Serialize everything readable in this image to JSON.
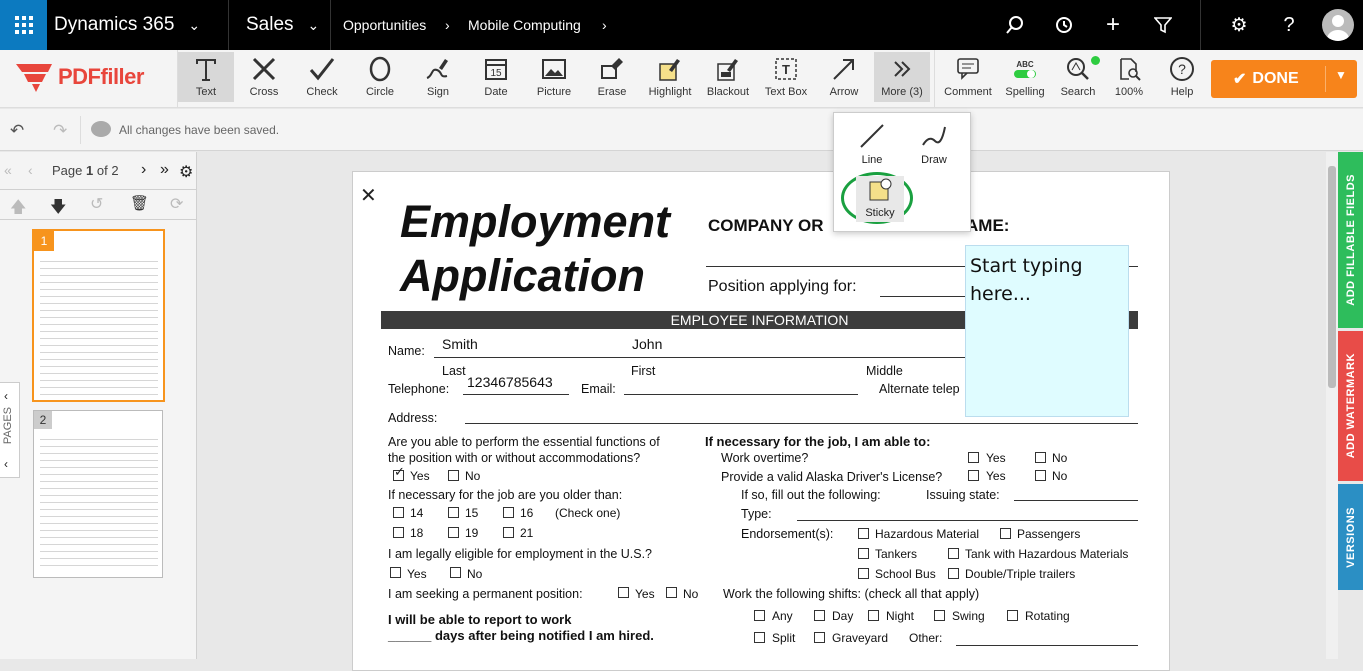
{
  "topbar": {
    "app": "Dynamics 365",
    "module": "Sales",
    "crumb1": "Opportunities",
    "crumb2": "Mobile Computing"
  },
  "logo": "PDFfiller",
  "tools": [
    {
      "label": "Text",
      "icon": "text-icon"
    },
    {
      "label": "Cross",
      "icon": "cross-icon"
    },
    {
      "label": "Check",
      "icon": "check-icon"
    },
    {
      "label": "Circle",
      "icon": "circle-icon"
    },
    {
      "label": "Sign",
      "icon": "sign-icon"
    },
    {
      "label": "Date",
      "icon": "date-icon"
    },
    {
      "label": "Picture",
      "icon": "picture-icon"
    },
    {
      "label": "Erase",
      "icon": "erase-icon"
    },
    {
      "label": "Highlight",
      "icon": "highlight-icon"
    },
    {
      "label": "Blackout",
      "icon": "blackout-icon"
    },
    {
      "label": "Text Box",
      "icon": "textbox-icon"
    },
    {
      "label": "Arrow",
      "icon": "arrow-icon"
    },
    {
      "label": "More (3)",
      "icon": "more-icon"
    }
  ],
  "tools2": [
    {
      "label": "Comment"
    },
    {
      "label": "Spelling",
      "sub": "ABC"
    },
    {
      "label": "Search"
    },
    {
      "label": "100%"
    },
    {
      "label": "Help"
    }
  ],
  "done": "DONE",
  "status": "All changes have been saved.",
  "pagenav": {
    "prefix": "Page",
    "current": "1",
    "of": "of 2"
  },
  "pages_label": "PAGES",
  "thumbs": [
    "1",
    "2"
  ],
  "popup": {
    "line": "Line",
    "draw": "Draw",
    "sticky": "Sticky"
  },
  "sidebar": {
    "fillable": "ADD FILLABLE FIELDS",
    "watermark": "ADD WATERMARK",
    "versions": "VERSIONS"
  },
  "sticky_text": "Start typing here...",
  "form": {
    "title1": "Employment",
    "title2": "Application",
    "company": "COMPANY OR",
    "company_tail": "AME:",
    "position": "Position applying for:",
    "section": "EMPLOYEE INFORMATION",
    "name": "Name:",
    "last_val": "Smith",
    "first_val": "John",
    "last": "Last",
    "first": "First",
    "middle": "Middle",
    "telephone": "Telephone:",
    "tel_val": "12346785643",
    "email": "Email:",
    "alt_tel": "Alternate telep",
    "address": "Address:",
    "q1a": "Are you able to perform the essential functions of",
    "q1b": "the position with or without accommodations?",
    "yes": "Yes",
    "no": "No",
    "q2": "If necessary for the job are you older than:",
    "ages": [
      "14",
      "15",
      "16",
      "18",
      "19",
      "21"
    ],
    "checkone": "(Check one)",
    "q3": "I am legally eligible for employment in the U.S.?",
    "q4": "I am seeking a permanent position:",
    "q5a": "I will be able to report to work",
    "q5b": "______ days after being notified I am hired.",
    "r_head": "If necessary for the job, I am able to:",
    "overtime": "Work overtime?",
    "license": "Provide a valid Alaska Driver's License?",
    "ifso": "If so, fill out the following:",
    "issuing": "Issuing state:",
    "type": "Type:",
    "endorse": "Endorsement(s):",
    "endorsements": [
      "Hazardous Material",
      "Passengers",
      "Tankers",
      "Tank with Hazardous Materials",
      "School Bus",
      "Double/Triple trailers"
    ],
    "shifts_head": "Work the following shifts: (check all that apply)",
    "shifts": [
      "Any",
      "Day",
      "Night",
      "Swing",
      "Rotating",
      "Split",
      "Graveyard"
    ],
    "other": "Other:"
  }
}
